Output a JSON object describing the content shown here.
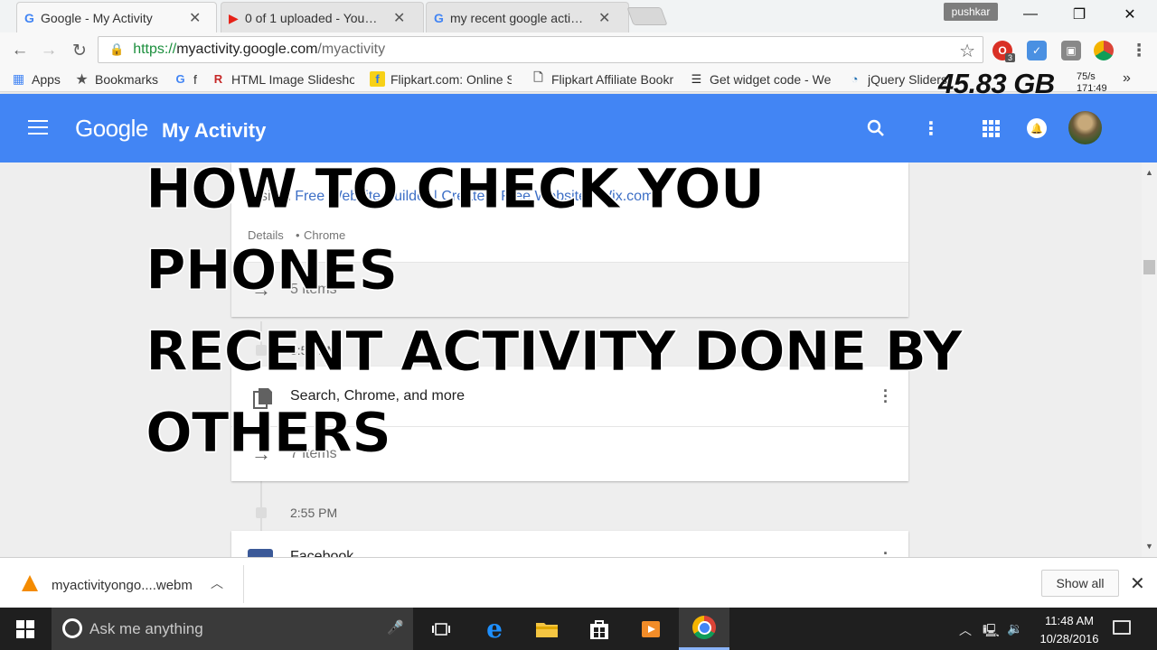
{
  "browser": {
    "tabs": [
      {
        "label": "Google - My Activity",
        "active": true
      },
      {
        "label": "0 of 1 uploaded - YouTube",
        "active": false
      },
      {
        "label": "my recent google activity",
        "active": false
      }
    ],
    "profile_name": "pushkar",
    "url": {
      "scheme": "https://",
      "host": "myactivity.google.com",
      "path": "/myactivity"
    },
    "extension_badge": "3",
    "bookmarks": [
      {
        "label": "Apps",
        "icon": "apps-grid-icon"
      },
      {
        "label": "Bookmarks",
        "icon": "star-icon"
      },
      {
        "label": "f",
        "icon": "google-icon"
      },
      {
        "label": "HTML Image Slideshow",
        "icon": "r-logo-icon"
      },
      {
        "label": "Flipkart.com: Online Shopping",
        "icon": "flipkart-icon"
      },
      {
        "label": "Flipkart Affiliate Bookmarklet",
        "icon": "page-icon"
      },
      {
        "label": "Get widget code - Web",
        "icon": "widget-icon"
      },
      {
        "label": "jQuery Sliders",
        "icon": "jquery-icon"
      }
    ],
    "storage_overlay": "45.83 GB",
    "rate_overlay": [
      "75/s",
      "171:49"
    ]
  },
  "google_header": {
    "logo": "Google",
    "title": "My Activity"
  },
  "activity": {
    "card1": {
      "visited_prefix": "Visited",
      "visited_link": "Free Website Builder | Create a Free Website | Wix.com",
      "details": "Details",
      "separator": "•",
      "app": "Chrome",
      "items": "5 items"
    },
    "time1": "3:58 PM",
    "card2": {
      "title": "Search, Chrome, and more",
      "items": "7 items"
    },
    "time2": "2:55 PM",
    "card3": {
      "title": "Facebook"
    }
  },
  "overlay_caption": [
    "HOW TO CHECK YOU PHONES",
    "RECENT ACTIVITY DONE BY",
    "OTHERS"
  ],
  "download_shelf": {
    "file_name": "myactivityongo....webm",
    "show_all": "Show all"
  },
  "taskbar": {
    "search_placeholder": "Ask me anything",
    "time": "11:48 AM",
    "date": "10/28/2016"
  },
  "colors": {
    "google_blue": "#4285f4",
    "secure_green": "#1b8f3d",
    "link_blue": "#3d6fc6",
    "taskbar": "#1f1f1f"
  }
}
